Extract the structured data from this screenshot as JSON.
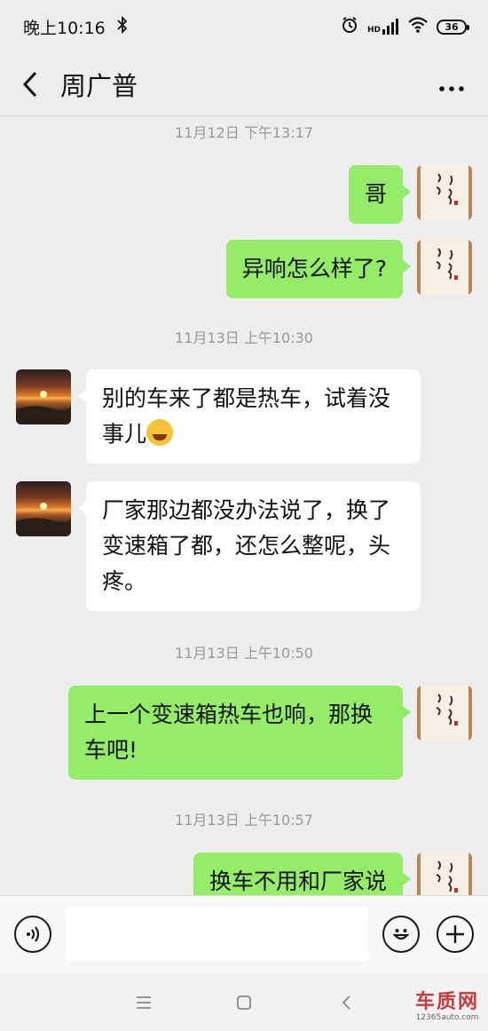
{
  "status_bar": {
    "time": "晚上10:16",
    "hd_label": "HD",
    "battery": "36",
    "icons": [
      "bluetooth-icon",
      "alarm-icon",
      "signal-icon",
      "wifi-icon",
      "battery-icon"
    ]
  },
  "header": {
    "title": "周广普",
    "back_icon": "chevron-left-icon",
    "more_label": "⋯"
  },
  "messages": {
    "ts1": "11月12日 下午13:17",
    "m1": "哥",
    "m2": "异响怎么样了?",
    "ts2": "11月13日 上午10:30",
    "m3": "别的车来了都是热车，试着没事儿",
    "m4": "厂家那边都没办法说了，换了变速箱了都，还怎么整呢，头疼。",
    "ts3": "11月13日 上午10:50",
    "m5": "上一个变速箱热车也响，那换车吧!",
    "ts4": "11月13日 上午10:57",
    "m6": "换车不用和厂家说"
  },
  "input_bar": {
    "text_value": "",
    "icons": [
      "voice-icon",
      "emoji-icon",
      "plus-icon"
    ]
  },
  "nav_bar": {
    "icons": [
      "menu-icon",
      "home-icon",
      "back-icon"
    ]
  },
  "watermark": {
    "logo": "车质网",
    "url": "12365auto.com"
  },
  "colors": {
    "background": "#ededed",
    "outgoing_bubble": "#95ec69",
    "incoming_bubble": "#ffffff",
    "timestamp": "#999999"
  }
}
